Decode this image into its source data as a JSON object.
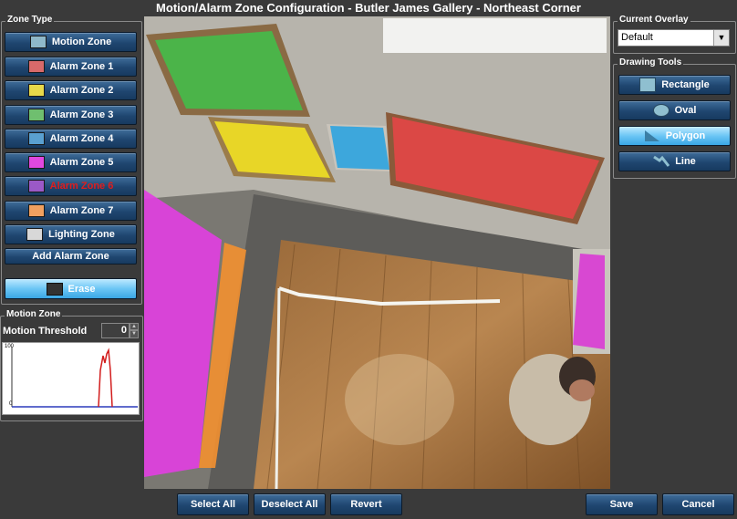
{
  "window": {
    "title": "Motion/Alarm Zone Configuration - Butler James Gallery - Northeast Corner"
  },
  "zone_type": {
    "label": "Zone Type",
    "buttons": [
      {
        "label": "Motion Zone",
        "color": "#8fb8c9"
      },
      {
        "label": "Alarm Zone 1",
        "color": "#d96a6a"
      },
      {
        "label": "Alarm Zone 2",
        "color": "#e8d94a"
      },
      {
        "label": "Alarm Zone 3",
        "color": "#6fbf6f"
      },
      {
        "label": "Alarm Zone 4",
        "color": "#5aa0d0"
      },
      {
        "label": "Alarm Zone 5",
        "color": "#e048e0"
      },
      {
        "label": "Alarm Zone 6",
        "color": "#9b59c7"
      },
      {
        "label": "Alarm Zone 7",
        "color": "#f0a060"
      },
      {
        "label": "Lighting Zone",
        "color": "#d8d8d8"
      }
    ],
    "add_alarm_zone": "Add Alarm Zone",
    "erase": "Erase"
  },
  "motion_zone": {
    "label": "Motion Zone",
    "threshold_label": "Motion Threshold",
    "threshold_value": "0",
    "graph_top_label": "100",
    "graph_zero_label": "0"
  },
  "current_overlay": {
    "label": "Current Overlay",
    "value": "Default"
  },
  "drawing_tools": {
    "label": "Drawing Tools",
    "rectangle": "Rectangle",
    "oval": "Oval",
    "polygon": "Polygon",
    "line": "Line"
  },
  "bottom": {
    "select_all": "Select All",
    "deselect_all": "Deselect All",
    "revert": "Revert",
    "save": "Save",
    "cancel": "Cancel"
  }
}
